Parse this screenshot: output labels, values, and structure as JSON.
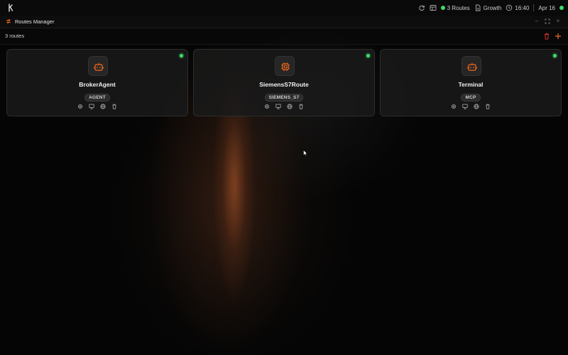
{
  "topbar": {
    "routes_label": "3 Routes",
    "file_label": "Growth",
    "time": "16:40",
    "date": "Apr 16"
  },
  "window": {
    "title": "Routes Manager"
  },
  "toolbar": {
    "count": "3 routes"
  },
  "routes": [
    {
      "name": "BrokerAgent",
      "badge": "AGENT",
      "icon": "robot-icon"
    },
    {
      "name": "SiemensS7Route",
      "badge": "SIEMENS_S7",
      "icon": "chip-icon"
    },
    {
      "name": "Terminal",
      "badge": "MCP",
      "icon": "robot-icon"
    }
  ],
  "colors": {
    "accent": "#f26a1b",
    "status_online": "#3ddc6a",
    "delete": "#d9342b"
  }
}
